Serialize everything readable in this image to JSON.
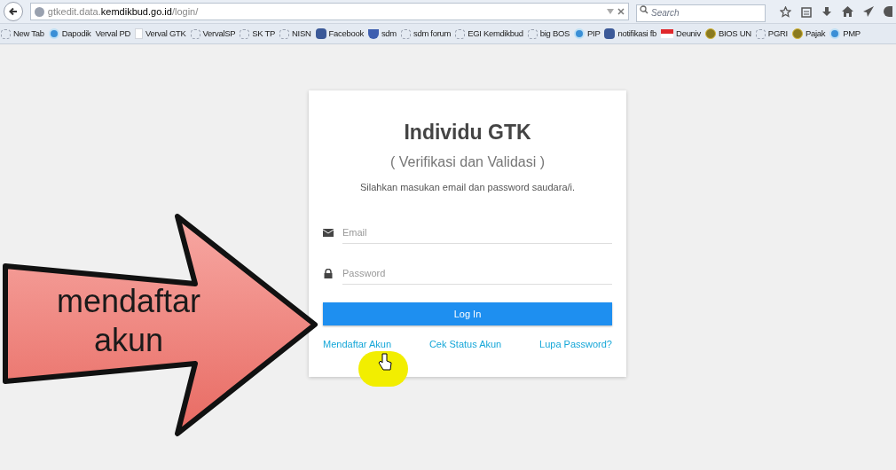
{
  "browser": {
    "url_prefix": "gtkedit.data.",
    "url_domain": "kemdikbud.go.id",
    "url_path": "/login/",
    "search_placeholder": "Search"
  },
  "bookmarks": [
    {
      "label": "New Tab",
      "kind": "blank"
    },
    {
      "label": "Dapodik",
      "kind": "globe"
    },
    {
      "label": "Verval PD",
      "kind": "none"
    },
    {
      "label": "Verval GTK",
      "kind": "page"
    },
    {
      "label": "VervalSP",
      "kind": "blank"
    },
    {
      "label": "SK TP",
      "kind": "blank"
    },
    {
      "label": "NISN",
      "kind": "blank"
    },
    {
      "label": "Facebook",
      "kind": "facebook"
    },
    {
      "label": "sdm",
      "kind": "shield"
    },
    {
      "label": "sdm forum",
      "kind": "blank"
    },
    {
      "label": "EGI Kemdikbud",
      "kind": "blank"
    },
    {
      "label": "big BOS",
      "kind": "blank"
    },
    {
      "label": "PIP",
      "kind": "globe"
    },
    {
      "label": "notifikasi fb",
      "kind": "facebook"
    },
    {
      "label": "Deuniv",
      "kind": "flag"
    },
    {
      "label": "BIOS UN",
      "kind": "emblem"
    },
    {
      "label": "PGRI",
      "kind": "blank"
    },
    {
      "label": "Pajak",
      "kind": "emblem"
    },
    {
      "label": "PMP",
      "kind": "globe"
    }
  ],
  "login": {
    "title": "Individu GTK",
    "subtitle": "( Verifikasi dan Validasi )",
    "instruction": "Silahkan masukan email dan password saudara/i.",
    "email_placeholder": "Email",
    "password_placeholder": "Password",
    "button": "Log In",
    "links": [
      "Mendaftar Akun",
      "Cek Status Akun",
      "Lupa Password?"
    ]
  },
  "annotation": {
    "text": "mendaftar akun"
  }
}
